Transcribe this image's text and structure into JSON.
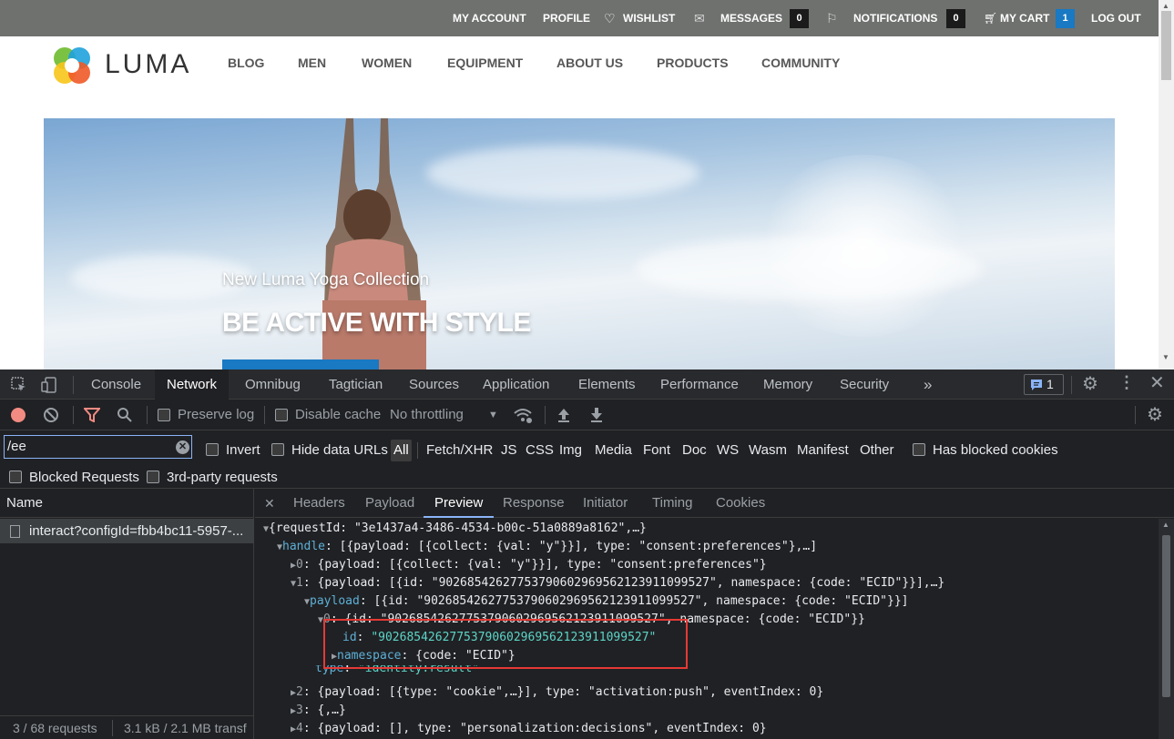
{
  "site": {
    "topbar": {
      "my_account": "MY ACCOUNT",
      "profile": "PROFILE",
      "wishlist": "WISHLIST",
      "messages": "MESSAGES",
      "messages_count": "0",
      "notifications": "NOTIFICATIONS",
      "notifications_count": "0",
      "my_cart": "MY CART",
      "cart_count": "1",
      "log_out": "LOG OUT"
    },
    "logo_text": "LUMA",
    "nav": [
      "BLOG",
      "MEN",
      "WOMEN",
      "EQUIPMENT",
      "ABOUT US",
      "PRODUCTS",
      "COMMUNITY"
    ],
    "hero": {
      "subtitle": "New Luma Yoga Collection",
      "title": "BE ACTIVE WITH STYLE"
    },
    "colors": {
      "topbar": "#6e716e",
      "accent": "#1979c3"
    }
  },
  "devtools": {
    "tabs": [
      "Console",
      "Network",
      "Omnibug",
      "Tagtician",
      "Sources",
      "Application",
      "Elements",
      "Performance",
      "Memory",
      "Security"
    ],
    "active_tab": "Network",
    "more_tabs": "»",
    "issues_count": "1",
    "toolbar": {
      "preserve_log": "Preserve log",
      "disable_cache": "Disable cache",
      "throttling": "No throttling"
    },
    "filter": {
      "value": "/ee",
      "invert": "Invert",
      "hide_data_urls": "Hide data URLs",
      "types": [
        "All",
        "Fetch/XHR",
        "JS",
        "CSS",
        "Img",
        "Media",
        "Font",
        "Doc",
        "WS",
        "Wasm",
        "Manifest",
        "Other"
      ],
      "has_blocked_cookies": "Has blocked cookies",
      "blocked_requests": "Blocked Requests",
      "third_party": "3rd-party requests"
    },
    "requests": {
      "header": "Name",
      "row": "interact?configId=fbb4bc11-5957-...",
      "status_count": "3 / 68 requests",
      "status_size": "3.1 kB / 2.1 MB transf"
    },
    "detail_tabs": [
      "Headers",
      "Payload",
      "Preview",
      "Response",
      "Initiator",
      "Timing",
      "Cookies"
    ],
    "detail_active": "Preview",
    "preview": {
      "l1_key": "{requestId: ",
      "l1_val": "\"3e1437a4-3486-4534-b00c-51a0889a8162\"",
      "l1_tail": ",…}",
      "l2_key": "handle",
      "l2_rest": ": [{payload: [{collect: {val: \"y\"}}], type: \"consent:preferences\"},…]",
      "l3_key": "0",
      "l3_rest": ": {payload: [{collect: {val: \"y\"}}], type: \"consent:preferences\"}",
      "l4_key": "1",
      "l4_rest": ": {payload: [{id: \"90268542627753790602969562123911099527\", namespace: {code: \"ECID\"}}],…}",
      "l5_key": "payload",
      "l5_rest": ": [{id: \"90268542627753790602969562123911099527\", namespace: {code: \"ECID\"}}]",
      "l6_key": "0",
      "l6_rest": ": {id: \"90268542627753790602969562123911099527\", namespace: {code: \"ECID\"}}",
      "l7_key": "id",
      "l7_val": "\"90268542627753790602969562123911099527\"",
      "l8_key": "namespace",
      "l8_rest": ": {code: \"ECID\"}",
      "l9_key": "type",
      "l9_val": "\"identity:result\"",
      "l10_key": "2",
      "l10_rest": ": {payload: [{type: \"cookie\",…}], type: \"activation:push\", eventIndex: 0}",
      "l11_key": "3",
      "l11_rest": ": {,…}",
      "l12_key": "4",
      "l12_rest": ": {payload: [], type: \"personalization:decisions\", eventIndex: 0}"
    }
  }
}
